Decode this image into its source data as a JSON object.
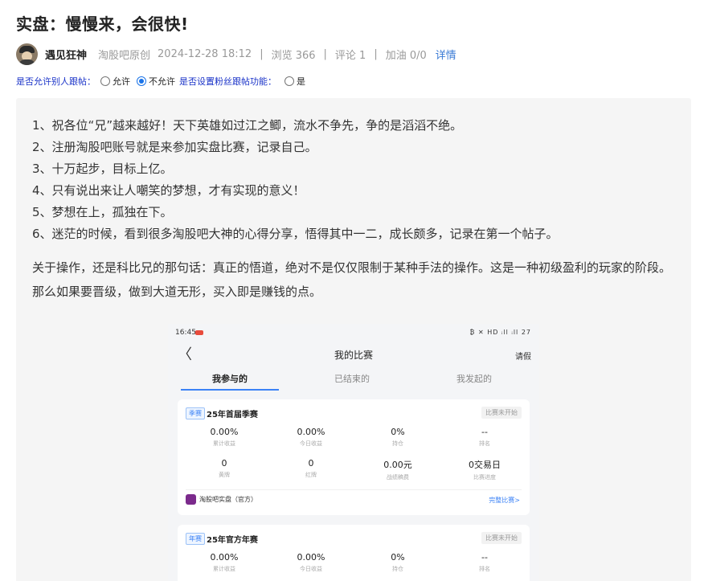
{
  "post": {
    "title": "实盘：慢慢来，会很快!",
    "author": "遇见狂神",
    "source": "淘股吧原创",
    "datetime": "2024-12-28 18:12",
    "views": "浏览 366",
    "comments": "评论 1",
    "cheers": "加油 0/0",
    "detail_link": "详情",
    "separator": "|"
  },
  "options": {
    "follow_label": "是否允许别人跟帖：",
    "allow": "允许",
    "disallow": "不允许",
    "fan_label": "是否设置粉丝跟帖功能：",
    "yes": "是",
    "selected": "disallow"
  },
  "content": {
    "list": [
      "1、祝各位“兄”越来越好！天下英雄如过江之鲫，流水不争先，争的是滔滔不绝。",
      "2、注册淘股吧账号就是来参加实盘比赛，记录自己。",
      "3、十万起步，目标上亿。",
      "4、只有说出来让人嘲笑的梦想，才有实现的意义！",
      "5、梦想在上，孤独在下。",
      "6、迷茫的时候，看到很多淘股吧大神的心得分享，悟得其中一二，成长颇多，记录在第一个帖子。"
    ],
    "paragraph": "关于操作，还是科比兄的那句话：真正的悟道，绝对不是仅仅限制于某种手法的操作。这是一种初级盈利的玩家的阶段。那么如果要晋级，做到大道无形，买入即是赚钱的点。"
  },
  "screenshot": {
    "time": "16:45",
    "status_icons": "₿ ✕ HD ᵢll ᵢll 27",
    "back": "〈",
    "nav_title": "我的比赛",
    "leave": "请假",
    "tabs": [
      "我参与的",
      "已结束的",
      "我发起的"
    ],
    "cards": [
      {
        "tag": "季赛",
        "name": "25年首届季赛",
        "status": "比赛未开始",
        "row1": [
          {
            "value": "0.00%",
            "label": "累计收益"
          },
          {
            "value": "0.00%",
            "label": "今日收益"
          },
          {
            "value": "0%",
            "label": "持仓"
          },
          {
            "value": "--",
            "label": "排名"
          }
        ],
        "row2": [
          {
            "value": "0",
            "label": "黄牌"
          },
          {
            "value": "0",
            "label": "红牌"
          },
          {
            "value": "0.00元",
            "label": "战绩稿费"
          },
          {
            "value": "0交易日",
            "label": "比赛进度"
          }
        ],
        "org": "淘股吧实盘（官方）",
        "link": "完整比赛>"
      },
      {
        "tag": "年赛",
        "name": "25年官方年赛",
        "status": "比赛未开始",
        "row1": [
          {
            "value": "0.00%",
            "label": "累计收益"
          },
          {
            "value": "0.00%",
            "label": "今日收益"
          },
          {
            "value": "0%",
            "label": "持仓"
          },
          {
            "value": "--",
            "label": "排名"
          }
        ]
      }
    ]
  }
}
